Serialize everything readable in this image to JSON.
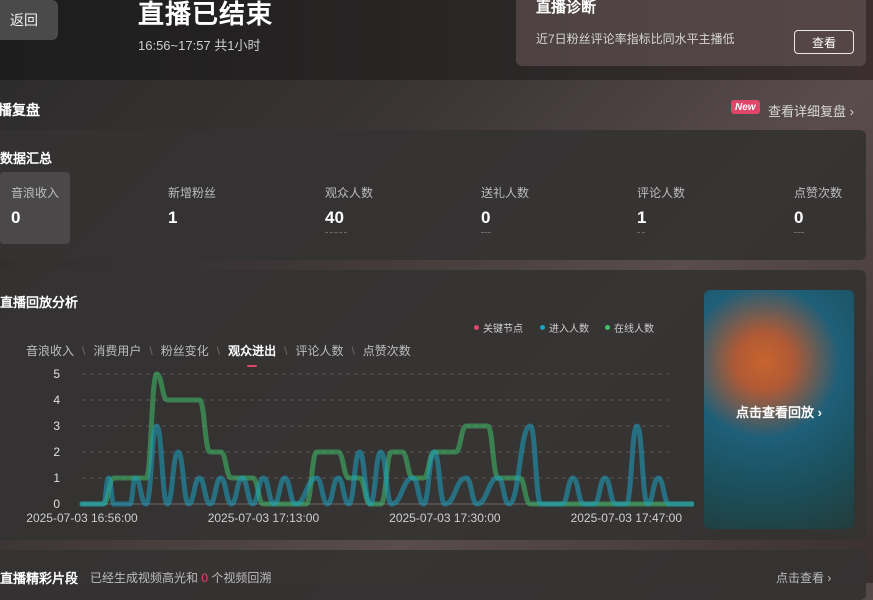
{
  "header": {
    "back_label": "返回",
    "title": "直播已结束",
    "time_range": "16:56~17:57 共1小时"
  },
  "diagnosis": {
    "title": "直播诊断",
    "description": "近7日粉丝评论率指标比同水平主播低",
    "button_label": "查看"
  },
  "review": {
    "title": "播复盘",
    "badge": "New",
    "detail_link": "查看详细复盘 ›"
  },
  "summary": {
    "title": "数据汇总",
    "metrics": [
      {
        "label": "音浪收入",
        "value": "0"
      },
      {
        "label": "新增粉丝",
        "value": "1"
      },
      {
        "label": "观众人数",
        "value": "40"
      },
      {
        "label": "送礼人数",
        "value": "0"
      },
      {
        "label": "评论人数",
        "value": "1"
      },
      {
        "label": "点赞次数",
        "value": "0"
      }
    ]
  },
  "analysis": {
    "title": "直播回放分析",
    "legend": [
      {
        "label": "关键节点",
        "color": "#e0456a"
      },
      {
        "label": "进入人数",
        "color": "#1aa3c2"
      },
      {
        "label": "在线人数",
        "color": "#3fbf6a"
      }
    ],
    "tabs": [
      "音浪收入",
      "消费用户",
      "粉丝变化",
      "观众进出",
      "评论人数",
      "点赞次数"
    ],
    "active_tab": 3,
    "replay_label": "点击查看回放 ›"
  },
  "chart_data": {
    "type": "line",
    "title": "",
    "xlabel": "",
    "ylabel": "",
    "ylim": [
      0,
      5
    ],
    "y_ticks": [
      "0",
      "1",
      "2",
      "3",
      "4",
      "5"
    ],
    "x_ticks": [
      {
        "minute": 0,
        "label": "2025-07-03 16:56:00"
      },
      {
        "minute": 17,
        "label": "2025-07-03 17:13:00"
      },
      {
        "minute": 34,
        "label": "2025-07-03 17:30:00"
      },
      {
        "minute": 51,
        "label": "2025-07-03 17:47:00"
      }
    ],
    "grid": true,
    "series": [
      {
        "name": "在线人数",
        "color": "#3fbf6a",
        "points": [
          [
            0,
            0
          ],
          [
            2,
            0
          ],
          [
            3,
            1
          ],
          [
            6,
            1
          ],
          [
            7,
            5
          ],
          [
            8,
            4
          ],
          [
            11,
            4
          ],
          [
            12,
            2
          ],
          [
            13,
            2
          ],
          [
            14,
            1
          ],
          [
            16,
            1
          ],
          [
            17,
            0
          ],
          [
            21,
            0
          ],
          [
            22,
            2
          ],
          [
            24,
            2
          ],
          [
            25,
            1
          ],
          [
            26,
            1
          ],
          [
            27,
            0
          ],
          [
            28,
            0
          ],
          [
            29,
            2
          ],
          [
            30,
            2
          ],
          [
            31,
            1
          ],
          [
            32,
            1
          ],
          [
            33,
            2
          ],
          [
            35,
            2
          ],
          [
            36,
            3
          ],
          [
            38,
            3
          ],
          [
            39,
            1
          ],
          [
            41,
            1
          ],
          [
            42,
            0
          ],
          [
            62,
            0
          ]
        ]
      },
      {
        "name": "进入人数",
        "color": "#1aa3c2",
        "points": [
          [
            0,
            0
          ],
          [
            2,
            0
          ],
          [
            2.5,
            1
          ],
          [
            3,
            0
          ],
          [
            4.5,
            0
          ],
          [
            5,
            1
          ],
          [
            6,
            0
          ],
          [
            7,
            3
          ],
          [
            8,
            0
          ],
          [
            9,
            2
          ],
          [
            10,
            0
          ],
          [
            11,
            1
          ],
          [
            12,
            0
          ],
          [
            13,
            1
          ],
          [
            14,
            0
          ],
          [
            15,
            1
          ],
          [
            16,
            0
          ],
          [
            17,
            1
          ],
          [
            18,
            0
          ],
          [
            19,
            1
          ],
          [
            20,
            0
          ],
          [
            22,
            1
          ],
          [
            23,
            0
          ],
          [
            24,
            1
          ],
          [
            25,
            0
          ],
          [
            26,
            2
          ],
          [
            27,
            0
          ],
          [
            28,
            2
          ],
          [
            29,
            0
          ],
          [
            31,
            1
          ],
          [
            32,
            0
          ],
          [
            33,
            2
          ],
          [
            34,
            0
          ],
          [
            36,
            1
          ],
          [
            37,
            0
          ],
          [
            39,
            1
          ],
          [
            40,
            0
          ],
          [
            42,
            3
          ],
          [
            43,
            0
          ],
          [
            45,
            0
          ],
          [
            46,
            1
          ],
          [
            47,
            0
          ],
          [
            48,
            0
          ],
          [
            49,
            1
          ],
          [
            50,
            0
          ],
          [
            51,
            0
          ],
          [
            52,
            3
          ],
          [
            53,
            0
          ],
          [
            54,
            1
          ],
          [
            55,
            0
          ],
          [
            62,
            0
          ]
        ]
      }
    ]
  },
  "highlights": {
    "title": "直播精彩片段",
    "desc_prefix": "已经生成视频高光和",
    "count": "0",
    "desc_suffix": "个视频回溯",
    "link": "点击查看 ›"
  }
}
